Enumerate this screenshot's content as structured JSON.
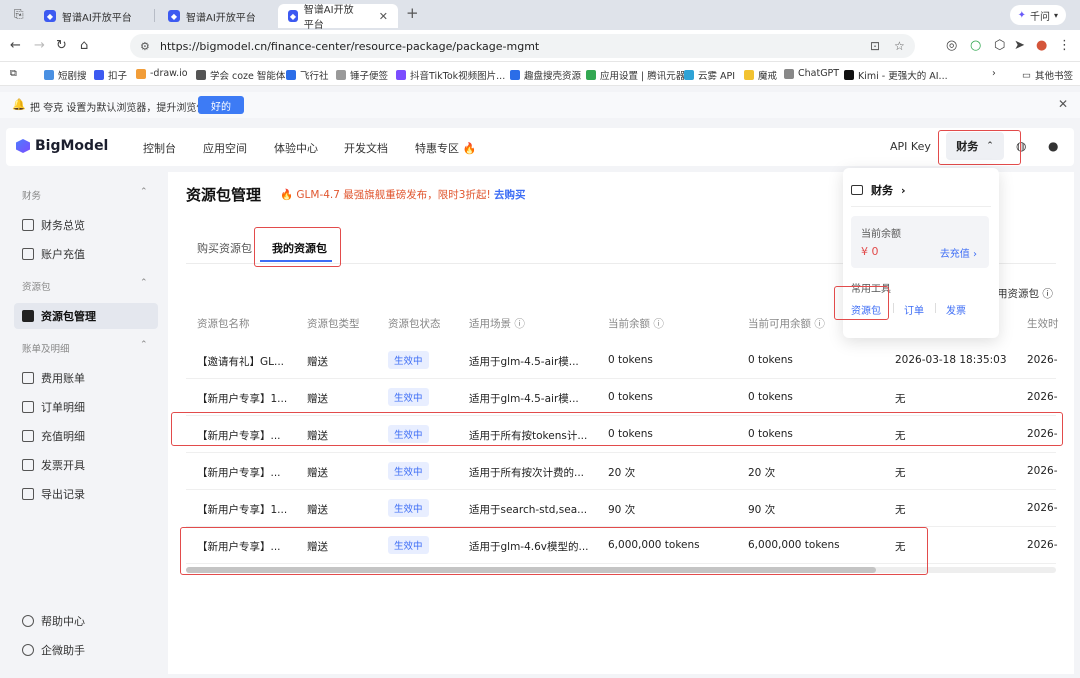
{
  "browser": {
    "tabs": [
      {
        "title": "智谱AI开放平台"
      },
      {
        "title": "智谱AI开放平台"
      },
      {
        "title": "智谱AI开放平台"
      }
    ],
    "user_label": "千问",
    "url": "https://bigmodel.cn/finance-center/resource-package/package-mgmt",
    "bookmarks": [
      "短剧搜",
      "扣子",
      "-draw.io",
      "学会 coze 智能体",
      "飞行社",
      "锤子便签",
      "抖音TikTok视频图片...",
      "趣盘搜壳资源",
      "应用设置 | 腾讯元器",
      "云雾 API",
      "魔戒",
      "ChatGPT",
      "Kimi - 更强大的 AI..."
    ],
    "other_bookmarks": "其他书签",
    "notice_text": "把 夸克 设置为默认浏览器，提升浏览体验",
    "notice_ok": "好的"
  },
  "header": {
    "logo": "BigModel",
    "nav": [
      "控制台",
      "应用空间",
      "体验中心",
      "开发文档",
      "特惠专区"
    ],
    "hot_icon": "🔥",
    "api_key": "API Key",
    "finance": "财务"
  },
  "sidebar": {
    "groups": [
      {
        "label": "财务",
        "items": [
          "财务总览",
          "账户充值"
        ]
      },
      {
        "label": "资源包",
        "items": [
          "资源包管理"
        ]
      },
      {
        "label": "账单及明细",
        "items": [
          "费用账单",
          "订单明细",
          "充值明细",
          "发票开具",
          "导出记录"
        ]
      }
    ],
    "footer": [
      "帮助中心",
      "企微助手"
    ]
  },
  "main": {
    "title": "资源包管理",
    "promo_text": "GLM-4.7 最强旗舰重磅发布，限时3折起!",
    "promo_link": "去购买",
    "tabs": [
      "购买资源包",
      "我的资源包"
    ],
    "columns": [
      "资源包名称",
      "资源包类型",
      "资源包状态",
      "适用场景",
      "当前余额",
      "当前可用余额",
      "",
      "生效时"
    ],
    "rows": [
      [
        "【邀请有礼】GL...",
        "赠送",
        "生效中",
        "适用于glm-4.5-air模...",
        "0 tokens",
        "0 tokens",
        "2026-03-18 18:35:03",
        "2026-"
      ],
      [
        "【新用户专享】1...",
        "赠送",
        "生效中",
        "适用于glm-4.5-air模...",
        "0 tokens",
        "0 tokens",
        "无",
        "2026-"
      ],
      [
        "【新用户专享】...",
        "赠送",
        "生效中",
        "适用于所有按tokens计...",
        "0 tokens",
        "0 tokens",
        "无",
        "2026-"
      ],
      [
        "【新用户专享】...",
        "赠送",
        "生效中",
        "适用于所有按次计费的...",
        "20 次",
        "20 次",
        "无",
        "2026-"
      ],
      [
        "【新用户专享】1...",
        "赠送",
        "生效中",
        "适用于search-std,sea...",
        "90 次",
        "90 次",
        "无",
        "2026-"
      ],
      [
        "【新用户专享】...",
        "赠送",
        "生效中",
        "适用于glm-4.6v模型的...",
        "6,000,000 tokens",
        "6,000,000 tokens",
        "无",
        "2026-"
      ]
    ],
    "partial_label": "用资源包"
  },
  "dropdown": {
    "title": "财务",
    "balance_label": "当前余额",
    "balance": "¥ 0",
    "recharge": "去充值",
    "tools_label": "常用工具",
    "links": [
      "资源包",
      "订单",
      "发票"
    ]
  }
}
